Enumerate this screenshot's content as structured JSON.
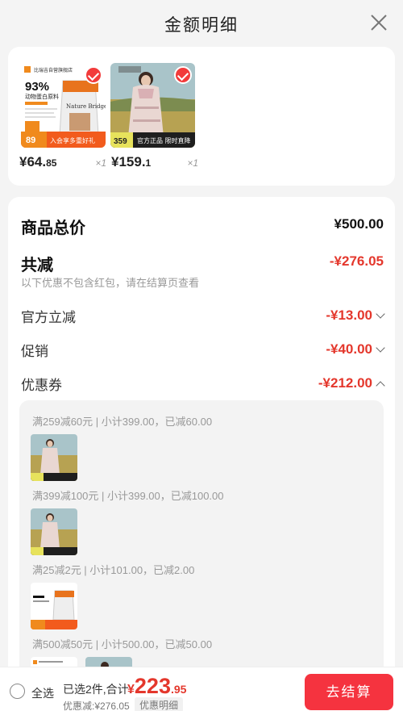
{
  "header": {
    "title": "金额明细"
  },
  "products": [
    {
      "price_int": "¥64.",
      "price_dec": "85",
      "qty": "×1",
      "store": "比瑞吉自营旗舰店",
      "pct": "93%",
      "tag": "动物蛋白原料",
      "brand": "Nature Bridge",
      "promo_price": "89",
      "promo_text": "入会享多重好礼"
    },
    {
      "price_int": "¥159.",
      "price_dec": "1",
      "qty": "×1",
      "promo_price": "359",
      "promo_text": "官方正品 限时直降"
    }
  ],
  "summary": {
    "total_label": "商品总价",
    "total_value": "¥500.00",
    "discount_label": "共减",
    "discount_value": "-¥276.05",
    "hint": "以下优惠不包含红包，请在结算页查看",
    "official_label": "官方立减",
    "official_value": "-¥13.00",
    "promo_label": "促销",
    "promo_value": "-¥40.00",
    "coupon_label": "优惠券",
    "coupon_value": "-¥212.00"
  },
  "coupons": [
    {
      "title": "满259减60元 | 小计399.00，已减60.00"
    },
    {
      "title": "满399减100元 | 小计399.00，已减100.00"
    },
    {
      "title": "满25减2元 | 小计101.00，已减2.00"
    },
    {
      "title": "满500减50元 | 小计500.00，已减50.00"
    }
  ],
  "bottom": {
    "select_all": "全选",
    "selected_text": "已选2件,合计:",
    "total_cur": "¥",
    "total_int": "223",
    "total_dec": ".95",
    "discount_text": "优惠减:¥276.05",
    "detail_link": "优惠明细",
    "checkout": "去结算"
  },
  "colors": {
    "accent": "#e4372c",
    "checkout": "#f5333f"
  }
}
